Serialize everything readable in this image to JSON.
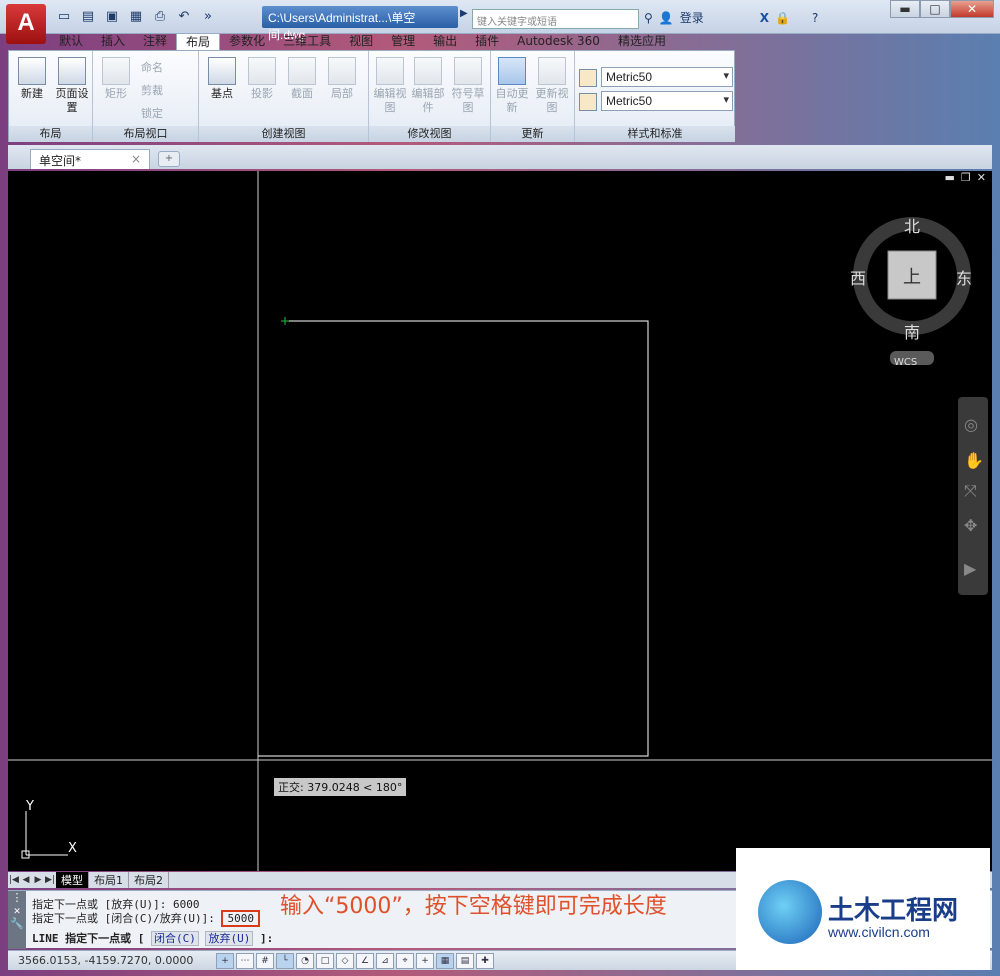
{
  "app": {
    "logo_letter": "A"
  },
  "title": {
    "path": "C:\\Users\\Administrat...\\单空间.dwg",
    "search_placeholder": "键入关键字或短语",
    "login": "登录"
  },
  "window": {
    "min": "▬",
    "max": "□",
    "close": "✕"
  },
  "tabs": [
    "默认",
    "插入",
    "注释",
    "布局",
    "参数化",
    "三维工具",
    "视图",
    "管理",
    "输出",
    "插件",
    "Autodesk 360",
    "精选应用"
  ],
  "ribbon": {
    "new_label": "新建",
    "page_setup_label": "页面设置",
    "rect_label": "矩形",
    "rename_label": "命名",
    "clip_label": "剪裁",
    "lock_label": "锁定",
    "base_label": "基点",
    "projected_label": "投影",
    "section_label": "截面",
    "detail_label": "局部",
    "edit_view_label": "编辑视图",
    "edit_component_label": "编辑部件",
    "symbol_sketch_label": "符号草图",
    "auto_update_label": "自动更新",
    "update_view_label": "更新视图",
    "style1": "Metric50",
    "style2": "Metric50",
    "groups": [
      "布局",
      "布局视口",
      "创建视图",
      "修改视图",
      "更新",
      "样式和标准"
    ]
  },
  "doc": {
    "tab": "单空间*"
  },
  "viewcube": {
    "north": "北",
    "south": "南",
    "west": "西",
    "east": "东",
    "face": "上",
    "wcs": "WCS"
  },
  "canvas": {
    "ortho_tooltip": "正交: 379.0248 < 180°",
    "axis_y": "Y",
    "axis_x": "X"
  },
  "layout_tabs": [
    "模型",
    "布局1",
    "布局2"
  ],
  "command": {
    "line1": "指定下一点或 [放弃(U)]: 6000",
    "line2_prefix": "指定下一点或 [闭合(C)/放弃(U)]:",
    "line2_value": "5000",
    "prompt": "LINE 指定下一点或 [",
    "opt_close": "闭合(C)",
    "opt_undo": "放弃(U)",
    "prompt_end": "]:"
  },
  "status": {
    "coords": "3566.0153, -4159.7270, 0.0000"
  },
  "annotation": "输入“5000”，按下空格键即可完成长度",
  "watermark": {
    "name": "土木工程网",
    "url": "www.civilcn.com"
  }
}
